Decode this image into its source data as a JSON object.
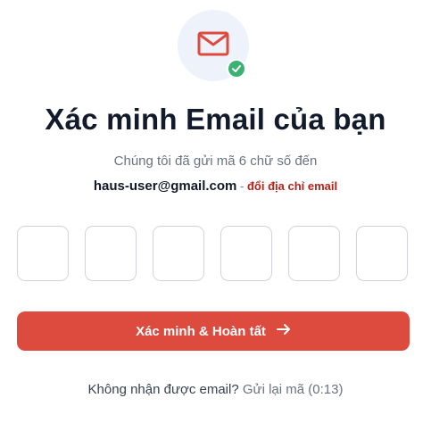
{
  "header": {
    "icon": "mail-icon",
    "badge_icon": "check-circle-icon"
  },
  "title": "Xác minh Email của bạn",
  "subtitle": "Chúng tôi đã gửi mã 6 chữ số đến",
  "email": {
    "address": "haus-user@gmail.com",
    "separator": " - ",
    "change_label": "đổi địa chỉ email"
  },
  "otp": {
    "digits": [
      "",
      "",
      "",
      "",
      "",
      ""
    ]
  },
  "submit": {
    "label": "Xác minh & Hoàn tất",
    "icon": "arrow-right-icon"
  },
  "resend": {
    "prompt": "Không nhận được email?",
    "action": "Gửi lại mã",
    "timer": "(0:13)"
  },
  "colors": {
    "accent": "#dd4b3e",
    "link": "#b42318",
    "success": "#3bb273",
    "icon_bg": "#eef2fb"
  }
}
